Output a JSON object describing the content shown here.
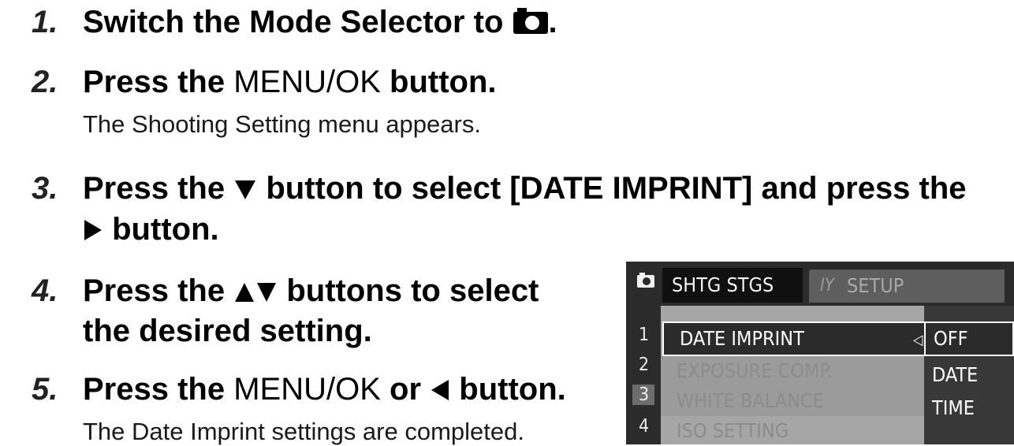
{
  "steps": [
    {
      "number": "1.",
      "text": "Switch the Mode Selector to",
      "end": "."
    },
    {
      "number": "2.",
      "text_a": "Press the",
      "text_b": "MENU/OK",
      "text_c": "button.",
      "sub": "The Shooting Setting menu appears."
    },
    {
      "number": "3.",
      "text_a": "Press the",
      "text_b": "button to select [DATE IMPRINT] and press the",
      "text_c": "button."
    },
    {
      "number": "4.",
      "text_a": "Press the",
      "text_b": "buttons to select",
      "text_c": "the desired setting."
    },
    {
      "number": "5.",
      "text_a": "Press the",
      "text_b": "MENU/OK",
      "text_c": "or",
      "text_d": "button.",
      "sub": "The Date Imprint settings are completed."
    }
  ],
  "screen": {
    "tab_active": "SHTG STGS",
    "tab_inactive_icon": "IY",
    "tab_inactive": "SETUP",
    "row_numbers": [
      "1",
      "2",
      "3",
      "4"
    ],
    "items": [
      "DATE IMPRINT",
      "EXPOSURE COMP.",
      "WHITE BALANCE",
      "ISO SETTING"
    ],
    "options": [
      "OFF",
      "DATE",
      "TIME"
    ]
  }
}
